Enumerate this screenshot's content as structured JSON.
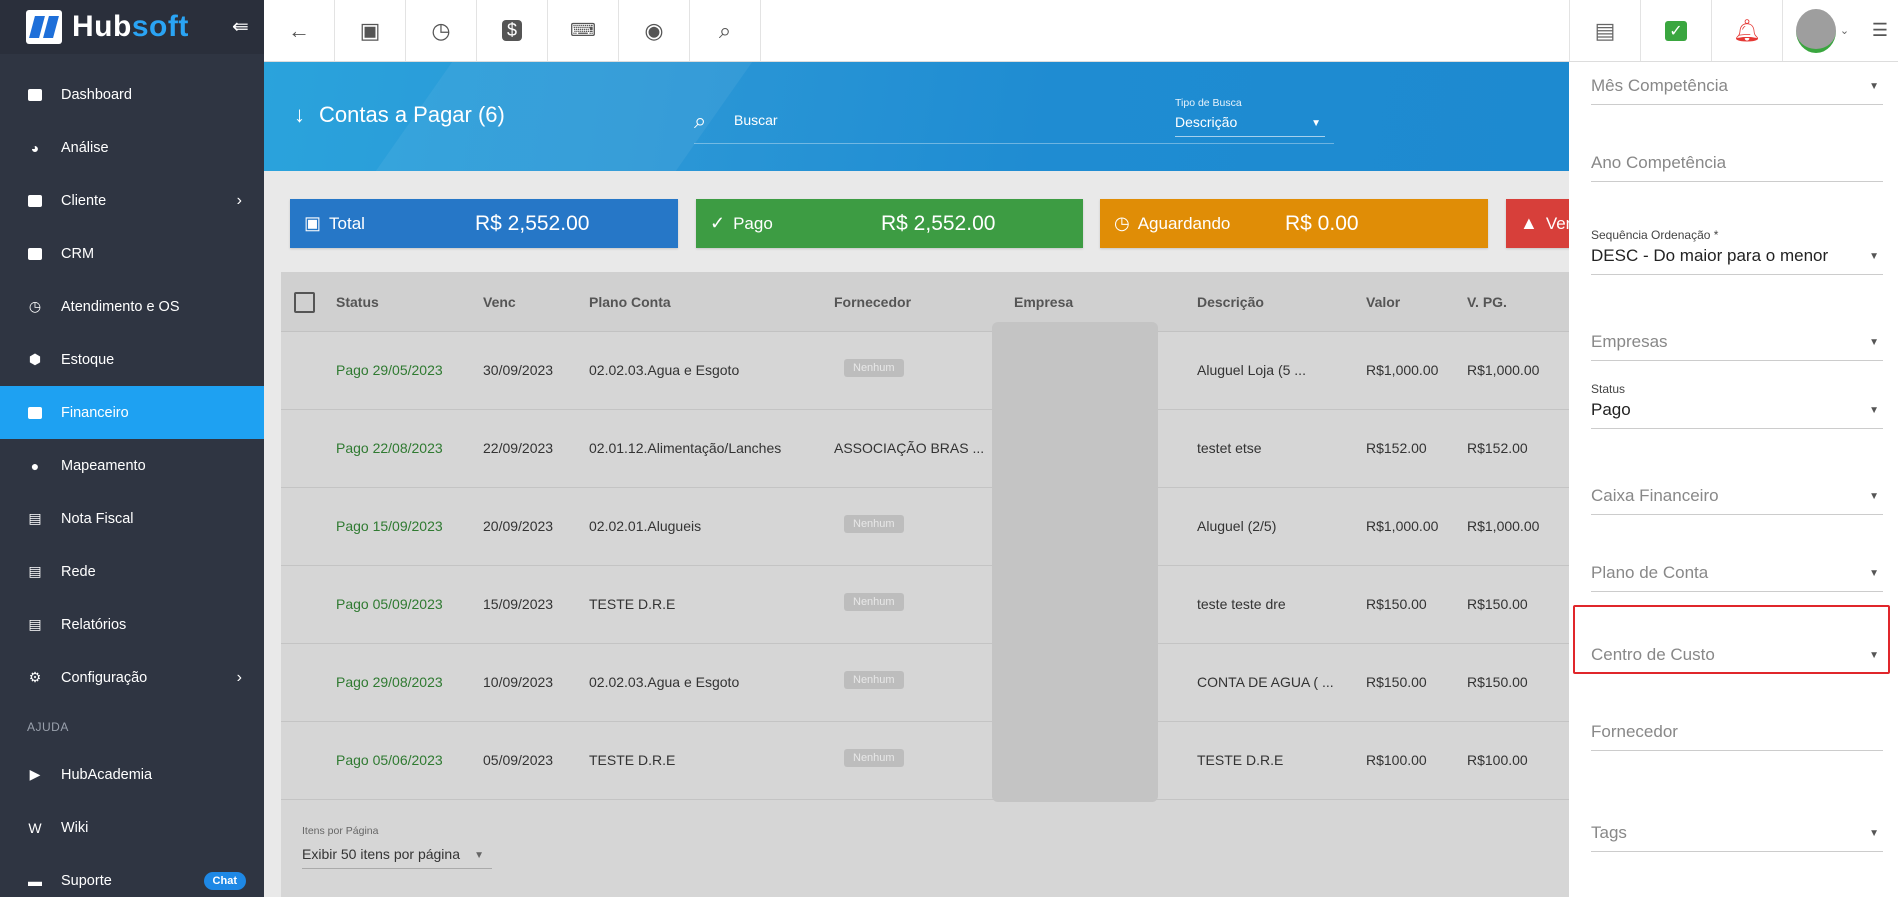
{
  "app": {
    "brand_main": "Hub",
    "brand_accent": "soft",
    "collapse_icon": "collapse-menu-icon"
  },
  "sidebar": {
    "items": [
      {
        "label": "Dashboard",
        "icon": "dashboard-icon"
      },
      {
        "label": "Análise",
        "icon": "pie-chart-icon"
      },
      {
        "label": "Cliente",
        "icon": "contact-card-icon",
        "has_submenu": true
      },
      {
        "label": "CRM",
        "icon": "board-icon"
      },
      {
        "label": "Atendimento e OS",
        "icon": "calendar-clock-icon"
      },
      {
        "label": "Estoque",
        "icon": "box-icon"
      },
      {
        "label": "Financeiro",
        "icon": "money-icon",
        "active": true
      },
      {
        "label": "Mapeamento",
        "icon": "map-pin-icon"
      },
      {
        "label": "Nota Fiscal",
        "icon": "receipt-icon"
      },
      {
        "label": "Rede",
        "icon": "network-icon"
      },
      {
        "label": "Relatórios",
        "icon": "document-icon"
      },
      {
        "label": "Configuração",
        "icon": "gear-icon",
        "has_submenu": true
      }
    ],
    "help_section_label": "AJUDA",
    "help_items": [
      {
        "label": "HubAcademia",
        "icon": "youtube-icon"
      },
      {
        "label": "Wiki",
        "icon": "wiki-icon"
      },
      {
        "label": "Suporte",
        "icon": "chat-icon",
        "badge": "Chat"
      }
    ]
  },
  "topbar": {
    "left_buttons": [
      "back-arrow-icon",
      "contact-card-icon",
      "calendar-clock-icon",
      "dollar-icon",
      "terminal-icon",
      "eye-icon",
      "search-icon"
    ],
    "right_buttons": [
      "pdf-icon",
      "check-message-icon",
      "alarm-bell-icon",
      "user-avatar",
      "list-icon"
    ],
    "colors": {
      "message": "#3aa63f",
      "alarm": "#e53935"
    }
  },
  "header": {
    "title": "Contas a Pagar (6)",
    "search_placeholder": "Buscar",
    "tipo_label": "Tipo de Busca",
    "tipo_value": "Descrição"
  },
  "cards": {
    "total": {
      "label": "Total",
      "amount": "R$ 2,552.00",
      "color": "#2677c7"
    },
    "pago": {
      "label": "Pago",
      "amount": "R$ 2,552.00",
      "color": "#3d9c43"
    },
    "aguardando": {
      "label": "Aguardando",
      "amount": "R$ 0.00",
      "color": "#e08d06"
    },
    "vencido": {
      "label": "Ven",
      "color": "#d73f3a"
    }
  },
  "table": {
    "columns": [
      "Status",
      "Venc",
      "Plano Conta",
      "Fornecedor",
      "Empresa",
      "Descrição",
      "Valor",
      "V. PG."
    ],
    "rows": [
      {
        "status": "Pago 29/05/2023",
        "venc": "30/09/2023",
        "plano": "02.02.03.Agua e Esgoto",
        "fornecedor": "Nenhum",
        "fornecedor_is_tag": true,
        "descricao": "Aluguel Loja (5 ...",
        "valor": "R$1,000.00",
        "vpg": "R$1,000.00"
      },
      {
        "status": "Pago 22/08/2023",
        "venc": "22/09/2023",
        "plano": "02.01.12.Alimentação/Lanches",
        "fornecedor": "ASSOCIAÇÃO BRAS ...",
        "fornecedor_is_tag": false,
        "descricao": "testet etse",
        "valor": "R$152.00",
        "vpg": "R$152.00"
      },
      {
        "status": "Pago 15/09/2023",
        "venc": "20/09/2023",
        "plano": "02.02.01.Alugueis",
        "fornecedor": "Nenhum",
        "fornecedor_is_tag": true,
        "descricao": "Aluguel (2/5)",
        "valor": "R$1,000.00",
        "vpg": "R$1,000.00"
      },
      {
        "status": "Pago 05/09/2023",
        "venc": "15/09/2023",
        "plano": "TESTE D.R.E",
        "fornecedor": "Nenhum",
        "fornecedor_is_tag": true,
        "descricao": "teste teste dre",
        "valor": "R$150.00",
        "vpg": "R$150.00"
      },
      {
        "status": "Pago 29/08/2023",
        "venc": "10/09/2023",
        "plano": "02.02.03.Agua e Esgoto",
        "fornecedor": "Nenhum",
        "fornecedor_is_tag": true,
        "descricao": "CONTA DE AGUA ( ...",
        "valor": "R$150.00",
        "vpg": "R$150.00"
      },
      {
        "status": "Pago 05/06/2023",
        "venc": "05/09/2023",
        "plano": "TESTE D.R.E",
        "fornecedor": "Nenhum",
        "fornecedor_is_tag": true,
        "descricao": "TESTE D.R.E",
        "valor": "R$100.00",
        "vpg": "R$100.00"
      }
    ],
    "pager_label": "Itens por Página",
    "pager_value": "Exibir 50 itens por página"
  },
  "filters": {
    "mes_competencia": "Mês Competência",
    "ano_competencia": "Ano Competência",
    "sequencia_label": "Sequência Ordenação *",
    "sequencia_value": "DESC - Do maior para o menor",
    "empresas": "Empresas",
    "status_label": "Status",
    "status_value": "Pago",
    "caixa": "Caixa Financeiro",
    "plano": "Plano de Conta",
    "centro_custo": "Centro de Custo",
    "fornecedor": "Fornecedor",
    "tags": "Tags"
  }
}
